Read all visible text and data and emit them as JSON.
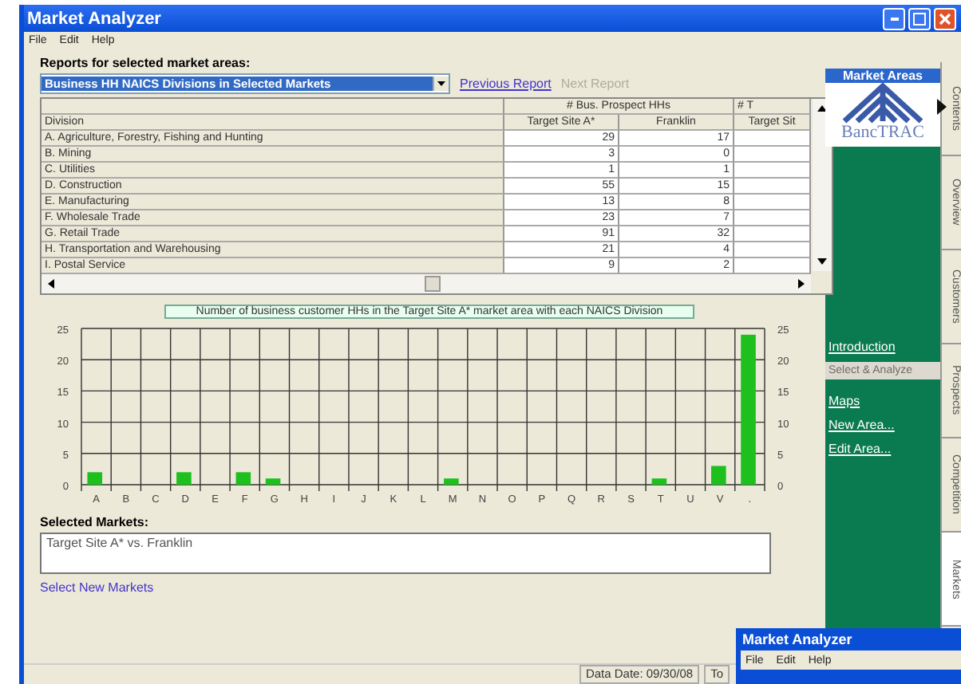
{
  "window": {
    "title": "Market Analyzer"
  },
  "menu": [
    "File",
    "Edit",
    "Help"
  ],
  "reports": {
    "label": "Reports for selected market areas:",
    "dropdown": "Business HH NAICS Divisions in Selected Markets",
    "previous": "Previous Report",
    "next": "Next Report",
    "next_disabled": true
  },
  "table": {
    "group_headers": [
      "# Bus. Prospect HHs",
      "# T"
    ],
    "columns": [
      "Division",
      "Target Site A*",
      "Franklin",
      "Target Sit"
    ],
    "rows": [
      {
        "division": "A. Agriculture, Forestry, Fishing and Hunting",
        "a": "29",
        "b": "17"
      },
      {
        "division": "B. Mining",
        "a": "3",
        "b": "0"
      },
      {
        "division": "C. Utilities",
        "a": "1",
        "b": "1"
      },
      {
        "division": "D. Construction",
        "a": "55",
        "b": "15"
      },
      {
        "division": "E. Manufacturing",
        "a": "13",
        "b": "8"
      },
      {
        "division": "F. Wholesale Trade",
        "a": "23",
        "b": "7"
      },
      {
        "division": "G. Retail Trade",
        "a": "91",
        "b": "32"
      },
      {
        "division": "H. Transportation and Warehousing",
        "a": "21",
        "b": "4"
      },
      {
        "division": "I. Postal Service",
        "a": "9",
        "b": "2"
      }
    ]
  },
  "chart": {
    "chart_data": {
      "type": "bar",
      "title": "Number of business customer HHs in the Target Site A* market area with each NAICS Division",
      "categories": [
        "A",
        "B",
        "C",
        "D",
        "E",
        "F",
        "G",
        "H",
        "I",
        "J",
        "K",
        "L",
        "M",
        "N",
        "O",
        "P",
        "Q",
        "R",
        "S",
        "T",
        "U",
        "V",
        "."
      ],
      "values": [
        2,
        0,
        0,
        2,
        0,
        2,
        1,
        0,
        0,
        0,
        0,
        0,
        1,
        0,
        0,
        0,
        0,
        0,
        0,
        1,
        0,
        3,
        24
      ],
      "ylim": [
        0,
        25
      ],
      "yticks": [
        0,
        5,
        10,
        15,
        20,
        25
      ],
      "y2ticks": [
        0,
        5,
        10,
        15,
        20,
        25
      ],
      "y2lim": [
        0,
        25
      ],
      "grid": true
    }
  },
  "selected_markets": {
    "label": "Selected Markets:",
    "value": "Target Site A* vs. Franklin",
    "link": "Select New Markets"
  },
  "status_bar": [
    "Data Date: 09/30/08",
    "To"
  ],
  "sidebar": {
    "header": "Market Areas",
    "logo_text": "BancTRAC",
    "items": [
      {
        "label": "Introduction",
        "kind": "link"
      },
      {
        "label": "Select & Analyze",
        "kind": "section"
      },
      {
        "label": "Maps",
        "kind": "link"
      },
      {
        "label": "New Area...",
        "kind": "link"
      },
      {
        "label": "Edit Area...",
        "kind": "link"
      }
    ]
  },
  "side_tabs": [
    {
      "label": "Contents",
      "selected": false
    },
    {
      "label": "Overview",
      "selected": false
    },
    {
      "label": "Customers",
      "selected": false
    },
    {
      "label": "Prospects",
      "selected": false
    },
    {
      "label": "Competition",
      "selected": false
    },
    {
      "label": "Markets",
      "selected": true
    }
  ],
  "overlay_window": {
    "title": "Market Analyzer",
    "menu": [
      "File",
      "Edit",
      "Help"
    ]
  }
}
